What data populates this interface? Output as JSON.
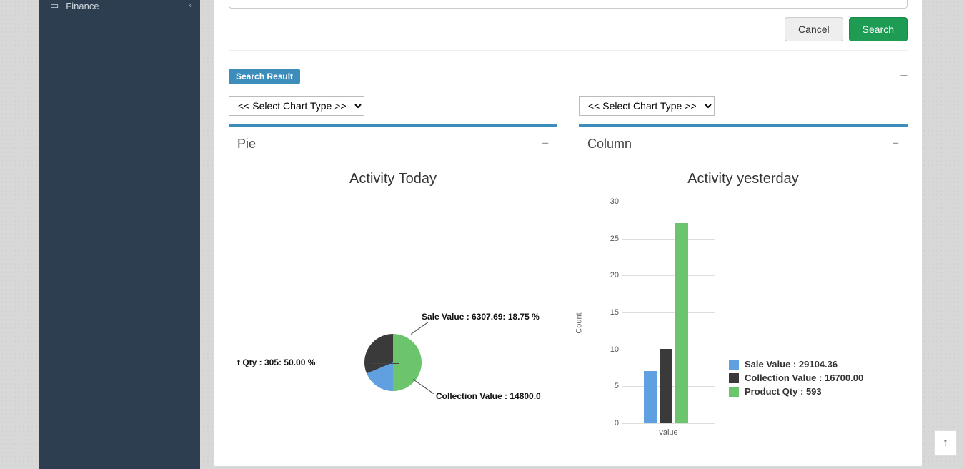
{
  "sidebar": {
    "items": [
      {
        "label": "Finance",
        "icon": "briefcase-icon"
      }
    ]
  },
  "buttons": {
    "cancel": "Cancel",
    "search": "Search"
  },
  "panel": {
    "badge": "Search Result"
  },
  "selectChartPlaceholder": "<< Select Chart Type >>",
  "pieCard": {
    "heading": "Pie",
    "title": "Activity Today",
    "slices": [
      {
        "label": "Sale Value : 6307.69: 18.75 %"
      },
      {
        "label": "Collection Value : 14800.0"
      },
      {
        "label": "t Qty : 305: 50.00 %"
      }
    ]
  },
  "columnCard": {
    "heading": "Column",
    "title": "Activity yesterday",
    "ylabel": "Count",
    "xlabel": "value",
    "legend": [
      {
        "label": "Sale Value : 29104.36",
        "color": "#61a0e0"
      },
      {
        "label": "Collection Value : 16700.00",
        "color": "#3a3a3a"
      },
      {
        "label": "Product Qty : 593",
        "color": "#6cc46c"
      }
    ]
  },
  "scrolltop": "↑",
  "chart_data": [
    {
      "type": "pie",
      "title": "Activity Today",
      "series": [
        {
          "name": "Product Qty",
          "value": 305,
          "percent": 50.0,
          "color": "#6cc46c"
        },
        {
          "name": "Sale Value",
          "value": 6307.69,
          "percent": 18.75,
          "color": "#61a0e0"
        },
        {
          "name": "Collection Value",
          "value": 14800.0,
          "percent": 31.25,
          "color": "#3a3a3a"
        }
      ]
    },
    {
      "type": "bar",
      "title": "Activity yesterday",
      "ylabel": "Count",
      "xlabel": "value",
      "ylim": [
        0,
        30
      ],
      "grid": true,
      "categories": [
        "Sale Value",
        "Collection Value",
        "Product Qty"
      ],
      "values": [
        7,
        10,
        27
      ],
      "raw_values": [
        29104.36,
        16700.0,
        593
      ],
      "colors": [
        "#61a0e0",
        "#3a3a3a",
        "#6cc46c"
      ]
    }
  ]
}
